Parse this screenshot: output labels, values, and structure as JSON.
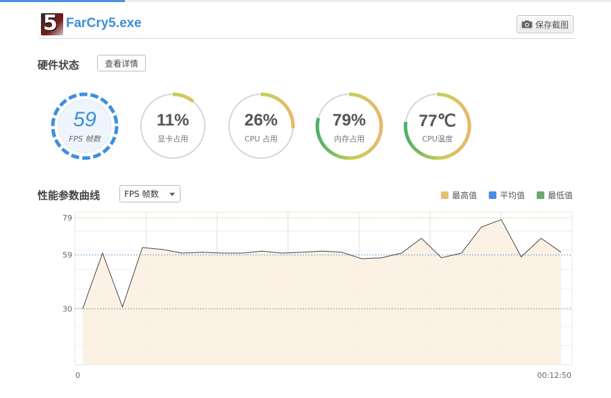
{
  "header": {
    "logo_text": "5",
    "title": "FarCry5.exe",
    "screenshot_label": "保存截图"
  },
  "hardware": {
    "title": "硬件状态",
    "details_label": "查看详情",
    "gauges": [
      {
        "id": "fps",
        "value": "59",
        "label": "FPS 帧数",
        "ratio": 1.0
      },
      {
        "id": "gpu",
        "value": "11%",
        "label": "显卡占用",
        "ratio": 0.11
      },
      {
        "id": "cpu",
        "value": "26%",
        "label": "CPU 占用",
        "ratio": 0.26
      },
      {
        "id": "mem",
        "value": "79%",
        "label": "内存占用",
        "ratio": 0.79
      },
      {
        "id": "temp",
        "value": "77℃",
        "label": "CPU温度",
        "ratio": 0.77
      }
    ]
  },
  "performance": {
    "title": "性能参数曲线",
    "selected_metric": "FPS 帧数",
    "legend": [
      {
        "label": "最高值",
        "color": "#e5c36e"
      },
      {
        "label": "平均值",
        "color": "#4a90e2"
      },
      {
        "label": "最低值",
        "color": "#6aaa6a"
      }
    ]
  },
  "chart_data": {
    "type": "area",
    "x_start_label": "0",
    "x_end_label": "00:12:50",
    "ylim": [
      0,
      82
    ],
    "y_ticks": [
      30,
      59,
      79
    ],
    "max_line": 79,
    "avg_line": 59,
    "min_line": 30,
    "grid": true,
    "series": [
      {
        "values": [
          30,
          60,
          31,
          63,
          62,
          60,
          60.5,
          60,
          60,
          61,
          60,
          60.5,
          61,
          60.5,
          57,
          57.5,
          60,
          68,
          57.5,
          60,
          74,
          78,
          58,
          68,
          60.5
        ]
      }
    ],
    "colors": {
      "line": "#444444",
      "fill": "#fbeee0"
    }
  }
}
